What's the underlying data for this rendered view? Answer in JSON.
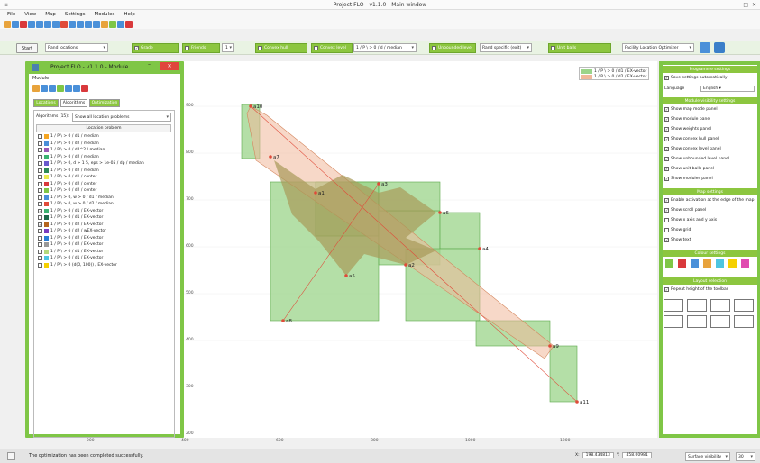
{
  "window": {
    "title": "Project FLO - v1.1.0 - Main window",
    "controls": [
      "–",
      "□",
      "✕"
    ]
  },
  "menu": [
    "File",
    "View",
    "Map",
    "Settings",
    "Modules",
    "Help"
  ],
  "toolbar_icons": [
    "#e8a33c",
    "#4a90d9",
    "#d9393c",
    "#4a90d9",
    "#4a90d9",
    "#4a90d9",
    "#4a90d9",
    "#e04b3a",
    "#4a90d9",
    "#4a90d9",
    "#4a90d9",
    "#4a90d9",
    "#e8a33c",
    "#7fc646",
    "#4a90d9",
    "#d9393c"
  ],
  "controlbar": {
    "start_label": "Start",
    "locations_combo": "Rand locations",
    "toggles": [
      {
        "label": "Grade",
        "checked": true
      },
      {
        "label": "Friends",
        "checked": false
      },
      {
        "label": "Convex hull",
        "checked": false
      },
      {
        "label": "Convex level",
        "checked": false
      },
      {
        "label": "Unbounded level",
        "checked": false
      },
      {
        "label": "Unit balls",
        "checked": false
      }
    ],
    "friends_value": "1",
    "convex_level_combo": "1 / P \\ > 0 / d / median",
    "unbounded_combo": "Rand specific (exit)",
    "facility_combo": "Facility Location Optimizer"
  },
  "module_window": {
    "title": "Project FLO - v1.1.0 - Module",
    "close": "✕",
    "module_label": "Module",
    "tabs": [
      "Locations",
      "Algorithms",
      "Optimization"
    ],
    "algorithms_label": "Algorithms (15):",
    "algorithms_combo": "Show all location problems",
    "list_header": "Location problem",
    "problems": [
      {
        "label": "1 / P \\ > 0 / d1 / median",
        "color": "#f5a623",
        "checked": false
      },
      {
        "label": "1 / P \\ > 0 / d2 / median",
        "color": "#4a90d9",
        "checked": false
      },
      {
        "label": "1 / P \\ > 0 / d2^2 / median",
        "color": "#9b59b6",
        "checked": false
      },
      {
        "label": "1 / P \\ > 0 / d2 / median",
        "color": "#3cb371",
        "checked": false
      },
      {
        "label": "1 / P \\ > 0, d > 1 5, eps > 1e-05 / dp / median",
        "color": "#6a5acd",
        "checked": false
      },
      {
        "label": "1 / P \\ > 0 / d2 / median",
        "color": "#2e8b57",
        "checked": false
      },
      {
        "label": "1 / P \\ > 0 / d1 / center",
        "color": "#e9e94f",
        "checked": false
      },
      {
        "label": "1 / P \\ > 0 / d2 / center",
        "color": "#d9393c",
        "checked": false
      },
      {
        "label": "1 / P \\ > 0 / d2 / center",
        "color": "#7fc646",
        "checked": false
      },
      {
        "label": "1 / P \\ > 0, w > 0 / d1 / median",
        "color": "#4a90d9",
        "checked": false
      },
      {
        "label": "1 / P \\ > 0, w > 0 / d2 / median",
        "color": "#e04b3a",
        "checked": false
      },
      {
        "label": "1 / P \\ > 0 / d1 / EX-vector",
        "color": "#3cb371",
        "checked": true
      },
      {
        "label": "1 / P \\ > 0 / d1 / EX-vector",
        "color": "#1f6b4a",
        "checked": false
      },
      {
        "label": "1 / P \\ > 0 / d2 / EX-vector",
        "color": "#b5651d",
        "checked": true
      },
      {
        "label": "1 / P \\ > 0 / d2 / wEX-vector",
        "color": "#7a3dbf",
        "checked": false
      },
      {
        "label": "1 / P \\ > 0 / d2 / EX-vector",
        "color": "#2a7fd4",
        "checked": false
      },
      {
        "label": "1 / P \\ > 0 / d2 / EX-vector",
        "color": "#999999",
        "checked": false
      },
      {
        "label": "1 / P \\ > 0 / d1 / EX-vector",
        "color": "#b3d97a",
        "checked": false
      },
      {
        "label": "1 / P \\ > 0 / d1 / EX-vector",
        "color": "#4ec5e0",
        "checked": false
      },
      {
        "label": "1 / P \\ > 0 (d(0, 100)) / EX-vector",
        "color": "#f5d000",
        "checked": false
      }
    ]
  },
  "plot": {
    "legend": [
      {
        "label": "1 / P \\ > 0 / d1 / EX-vector",
        "color": "#9bd48a"
      },
      {
        "label": "1 / P \\ > 0 / d2 / EX-vector",
        "color": "#f0b89a"
      }
    ],
    "x_ticks": [
      "200",
      "400",
      "600",
      "800",
      "1000",
      "1200"
    ],
    "y_ticks": [
      "900",
      "800",
      "700",
      "600",
      "500",
      "400",
      "300",
      "200"
    ],
    "points": [
      {
        "label": "a10"
      },
      {
        "label": "a7"
      },
      {
        "label": "a1"
      },
      {
        "label": "a3"
      },
      {
        "label": "a6"
      },
      {
        "label": "a4"
      },
      {
        "label": "a2"
      },
      {
        "label": "a5"
      },
      {
        "label": "a8"
      },
      {
        "label": "a9"
      },
      {
        "label": "a11"
      }
    ]
  },
  "right_panel": {
    "sections": [
      {
        "title": "Programme settings",
        "rows": [
          {
            "label": "Save settings automatically",
            "checked": true
          },
          {
            "label": "Language",
            "combo": "English"
          }
        ]
      },
      {
        "title": "Module visibility settings",
        "rows": [
          {
            "label": "Show map mode panel",
            "checked": true
          },
          {
            "label": "Show module panel",
            "checked": true
          },
          {
            "label": "Show weights panel",
            "checked": true
          },
          {
            "label": "Show convex hull panel",
            "checked": true
          },
          {
            "label": "Show convex level panel",
            "checked": true
          },
          {
            "label": "Show unbounded level panel",
            "checked": true
          },
          {
            "label": "Show unit balls panel",
            "checked": true
          },
          {
            "label": "Show modules panel",
            "checked": true
          }
        ]
      },
      {
        "title": "Map settings",
        "rows": [
          {
            "label": "Enable activation at the edge of the map",
            "checked": true
          },
          {
            "label": "Show scroll panel",
            "checked": true
          },
          {
            "label": "Show x axis and y axis",
            "checked": false
          },
          {
            "label": "Show grid",
            "checked": false
          },
          {
            "label": "Show text",
            "checked": true
          }
        ]
      },
      {
        "title": "Colour settings",
        "colors": [
          "#7fc646",
          "#d9393c",
          "#4a90d9",
          "#e8a33c",
          "#4ec5e0",
          "#f5d000",
          "#e04bb0"
        ]
      },
      {
        "title": "Layout selection",
        "rows": [
          {
            "label": "Repeat height of the toolbar",
            "checked": true
          }
        ]
      }
    ]
  },
  "statusbar": {
    "message": "The optimization has been completed successfully.",
    "x_label": "X:",
    "x_value": "198.434813",
    "y_label": "Y:",
    "y_value": "458.00981",
    "mode_combo": "Surface visibility",
    "zoom": "30"
  }
}
